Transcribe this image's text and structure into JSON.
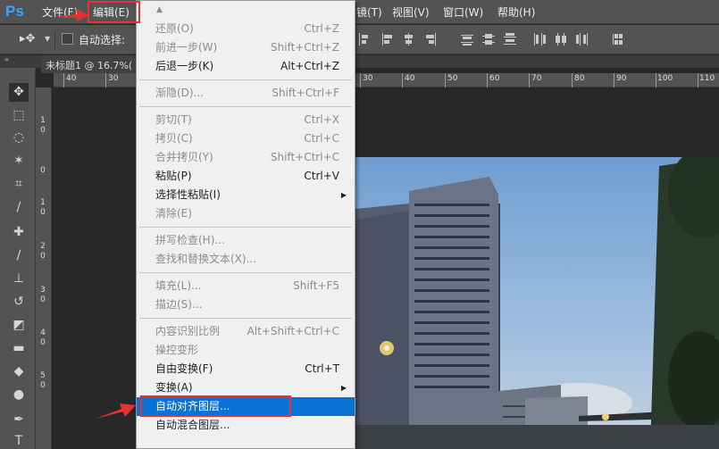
{
  "app": {
    "logo": "Ps"
  },
  "menubar": {
    "file": "文件(F)",
    "edit": "编辑(E)",
    "filter_partial": "镜(T)",
    "view": "视图(V)",
    "window": "窗口(W)",
    "help": "帮助(H)"
  },
  "options": {
    "auto_select_label": "自动选择:"
  },
  "document": {
    "tab_title": "未标题1 @ 16.7%("
  },
  "rulers": {
    "h_left": [
      "40",
      "30"
    ],
    "h_right": [
      "30",
      "40",
      "50",
      "60",
      "70",
      "80",
      "90",
      "100",
      "110"
    ],
    "v": [
      "1\n0",
      "0",
      "1\n0",
      "2\n0",
      "3\n0",
      "4\n0",
      "5\n0"
    ]
  },
  "edit_menu": {
    "items": [
      {
        "label": "还原(O)",
        "shortcut": "Ctrl+Z",
        "enabled": false
      },
      {
        "label": "前进一步(W)",
        "shortcut": "Shift+Ctrl+Z",
        "enabled": false
      },
      {
        "label": "后退一步(K)",
        "shortcut": "Alt+Ctrl+Z",
        "enabled": true
      },
      {
        "label": "渐隐(D)...",
        "shortcut": "Shift+Ctrl+F",
        "enabled": false
      },
      {
        "label": "剪切(T)",
        "shortcut": "Ctrl+X",
        "enabled": false
      },
      {
        "label": "拷贝(C)",
        "shortcut": "Ctrl+C",
        "enabled": false
      },
      {
        "label": "合并拷贝(Y)",
        "shortcut": "Shift+Ctrl+C",
        "enabled": false
      },
      {
        "label": "粘贴(P)",
        "shortcut": "Ctrl+V",
        "enabled": true
      },
      {
        "label": "选择性粘贴(I)",
        "shortcut": "",
        "enabled": true,
        "submenu": true
      },
      {
        "label": "清除(E)",
        "shortcut": "",
        "enabled": false
      },
      {
        "label": "拼写检查(H)...",
        "shortcut": "",
        "enabled": false
      },
      {
        "label": "查找和替换文本(X)...",
        "shortcut": "",
        "enabled": false
      },
      {
        "label": "填充(L)...",
        "shortcut": "Shift+F5",
        "enabled": false
      },
      {
        "label": "描边(S)...",
        "shortcut": "",
        "enabled": false
      },
      {
        "label": "内容识别比例",
        "shortcut": "Alt+Shift+Ctrl+C",
        "enabled": false
      },
      {
        "label": "操控变形",
        "shortcut": "",
        "enabled": false
      },
      {
        "label": "自由变换(F)",
        "shortcut": "Ctrl+T",
        "enabled": true
      },
      {
        "label": "变换(A)",
        "shortcut": "",
        "enabled": true,
        "submenu": true
      },
      {
        "label": "自动对齐图层...",
        "shortcut": "",
        "enabled": true,
        "highlighted": true
      },
      {
        "label": "自动混合图层...",
        "shortcut": "",
        "enabled": true
      }
    ]
  },
  "colors": {
    "highlight": "#0a72d6",
    "annotation_red": "#e53333",
    "logo_blue": "#31a8ff"
  }
}
